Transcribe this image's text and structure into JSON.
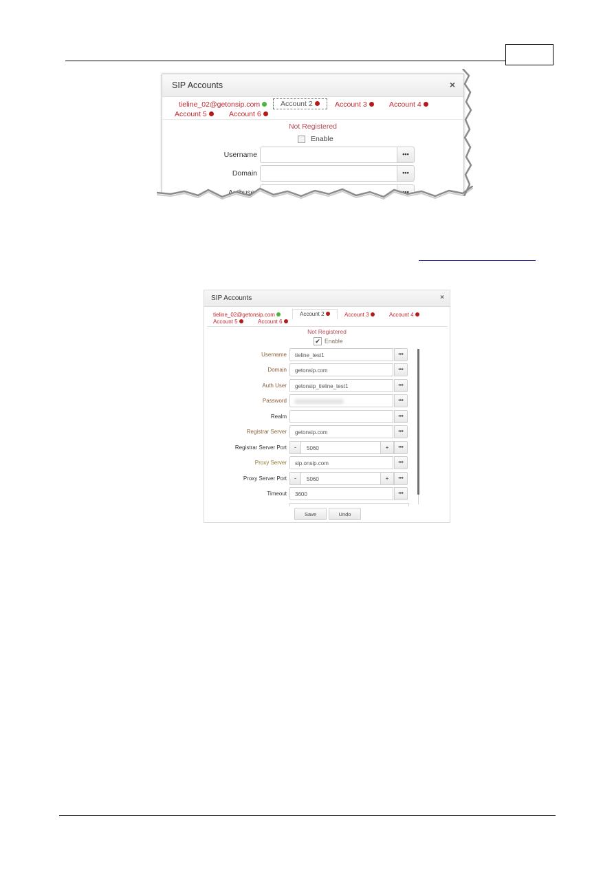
{
  "page": {
    "header_page_number": "",
    "hyperlink_text": ""
  },
  "dialog_1": {
    "title": "SIP Accounts",
    "close_icon": "×",
    "tabs": [
      {
        "label": "tieline_02@getonsip.com",
        "status": "registered",
        "status_color": "#4ab43c"
      },
      {
        "label": "Account 2",
        "status": "not-registered",
        "status_color": "#b51a1a",
        "active": true
      },
      {
        "label": "Account 3",
        "status": "not-registered",
        "status_color": "#b51a1a"
      },
      {
        "label": "Account 4",
        "status": "not-registered",
        "status_color": "#b51a1a"
      },
      {
        "label": "Account 5",
        "status": "not-registered",
        "status_color": "#b51a1a"
      },
      {
        "label": "Account 6",
        "status": "not-registered",
        "status_color": "#b51a1a"
      }
    ],
    "status_text": "Not Registered",
    "enable": {
      "label": "Enable",
      "checked": false
    },
    "fields": [
      {
        "label": "Username",
        "value": "",
        "button": "•••"
      },
      {
        "label": "Domain",
        "value": "",
        "button": "•••"
      },
      {
        "label": "Authuser",
        "value": "",
        "button": "•••"
      }
    ]
  },
  "dialog_2": {
    "title": "SIP Accounts",
    "close_icon": "×",
    "tabs": [
      {
        "label": "tieline_02@getonsip.com",
        "status": "registered",
        "status_color": "#4ab43c"
      },
      {
        "label": "Account 2",
        "status": "not-registered",
        "status_color": "#b51a1a",
        "active": true
      },
      {
        "label": "Account 3",
        "status": "not-registered",
        "status_color": "#b51a1a"
      },
      {
        "label": "Account 4",
        "status": "not-registered",
        "status_color": "#b51a1a"
      },
      {
        "label": "Account 5",
        "status": "not-registered",
        "status_color": "#b51a1a"
      },
      {
        "label": "Account 6",
        "status": "not-registered",
        "status_color": "#b51a1a"
      }
    ],
    "status_text": "Not Registered",
    "enable": {
      "label": "Enable",
      "checked": true,
      "check_glyph": "✔"
    },
    "fields": [
      {
        "label": "Username",
        "value": "tieline_test1",
        "button": "•••"
      },
      {
        "label": "Domain",
        "value": "getonsip.com",
        "button": "•••"
      },
      {
        "label": "Auth User",
        "value": "getonsip_tieline_test1",
        "button": "•••"
      },
      {
        "label": "Password",
        "value": "",
        "masked": true,
        "button": "•••"
      },
      {
        "label": "Realm",
        "value": "",
        "button": "•••"
      },
      {
        "label": "Registrar Server",
        "value": "getonsip.com",
        "button": "•••"
      },
      {
        "label": "Registrar Server Port",
        "value": "5060",
        "minus": "-",
        "plus": "+",
        "button": "•••"
      },
      {
        "label": "Proxy Server",
        "value": "sip.onsip.com",
        "button": "•••"
      },
      {
        "label": "Proxy Server Port",
        "value": "5060",
        "minus": "-",
        "plus": "+",
        "button": "•••"
      },
      {
        "label": "Timeout",
        "value": "3600",
        "button": "•••"
      }
    ],
    "save_label": "Save",
    "undo_label": "Undo"
  }
}
